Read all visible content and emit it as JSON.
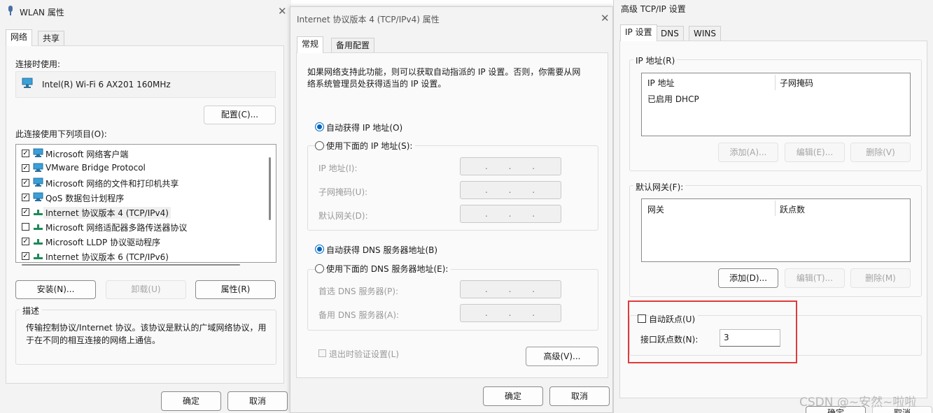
{
  "wlan": {
    "title": "WLAN 属性",
    "tabs": [
      "网络",
      "共享"
    ],
    "connect_using_label": "连接时使用:",
    "adapter": "Intel(R) Wi-Fi 6 AX201 160MHz",
    "configure_btn": "配置(C)...",
    "items_label": "此连接使用下列项目(O):",
    "items": [
      {
        "label": "Microsoft 网络客户端",
        "checked": true,
        "icon": "network-client-icon"
      },
      {
        "label": "VMware Bridge Protocol",
        "checked": true,
        "icon": "network-client-icon"
      },
      {
        "label": "Microsoft 网络的文件和打印机共享",
        "checked": true,
        "icon": "network-client-icon"
      },
      {
        "label": "QoS 数据包计划程序",
        "checked": true,
        "icon": "network-client-icon"
      },
      {
        "label": "Internet 协议版本 4 (TCP/IPv4)",
        "checked": true,
        "icon": "protocol-icon",
        "selected": true
      },
      {
        "label": "Microsoft 网络适配器多路传送器协议",
        "checked": false,
        "icon": "protocol-icon"
      },
      {
        "label": "Microsoft LLDP 协议驱动程序",
        "checked": true,
        "icon": "protocol-icon"
      },
      {
        "label": "Internet 协议版本 6 (TCP/IPv6)",
        "checked": true,
        "icon": "protocol-icon"
      }
    ],
    "install_btn": "安装(N)...",
    "uninstall_btn": "卸载(U)",
    "properties_btn": "属性(R)",
    "desc_label": "描述",
    "desc_text_1": "传输控制协议/Internet 协议。该协议是默认的广域网络协议，用",
    "desc_text_2": "于在不同的相互连接的网络上通信。",
    "ok_btn": "确定",
    "cancel_btn": "取消"
  },
  "ipv4": {
    "title": "Internet 协议版本 4 (TCP/IPv4) 属性",
    "tabs": [
      "常规",
      "备用配置"
    ],
    "info_1": "如果网络支持此功能，则可以获取自动指派的 IP 设置。否则，你需要从网",
    "info_2": "络系统管理员处获得适当的 IP 设置。",
    "auto_ip": "自动获得 IP 地址(O)",
    "manual_ip": "使用下面的 IP 地址(S):",
    "ip_label": "IP 地址(I):",
    "mask_label": "子网掩码(U):",
    "gateway_label": "默认网关(D):",
    "auto_dns": "自动获得 DNS 服务器地址(B)",
    "manual_dns": "使用下面的 DNS 服务器地址(E):",
    "pref_dns": "首选 DNS 服务器(P):",
    "alt_dns": "备用 DNS 服务器(A):",
    "ip_placeholder": ". . .",
    "validate": "退出时验证设置(L)",
    "advanced_btn": "高级(V)...",
    "ok_btn": "确定",
    "cancel_btn": "取消"
  },
  "adv": {
    "title": "高级 TCP/IP 设置",
    "tabs": [
      "IP 设置",
      "DNS",
      "WINS"
    ],
    "ip_group": "IP 地址(R)",
    "ip_cols": [
      "IP 地址",
      "子网掩码"
    ],
    "ip_row": "已启用 DHCP",
    "add_btn": "添加(A)...",
    "edit_btn": "编辑(E)...",
    "del_btn": "删除(V)",
    "gw_group": "默认网关(F):",
    "gw_cols": [
      "网关",
      "跃点数"
    ],
    "gw_add": "添加(D)...",
    "gw_edit": "编辑(T)...",
    "gw_del": "删除(M)",
    "auto_metric": "自动跃点(U)",
    "metric_label": "接口跃点数(N):",
    "metric_value": "3",
    "ok_partial": "确定",
    "cancel_partial": "取消",
    "highlight_color": "#e23a3a"
  },
  "watermark": "CSDN @~安然~啦啦"
}
